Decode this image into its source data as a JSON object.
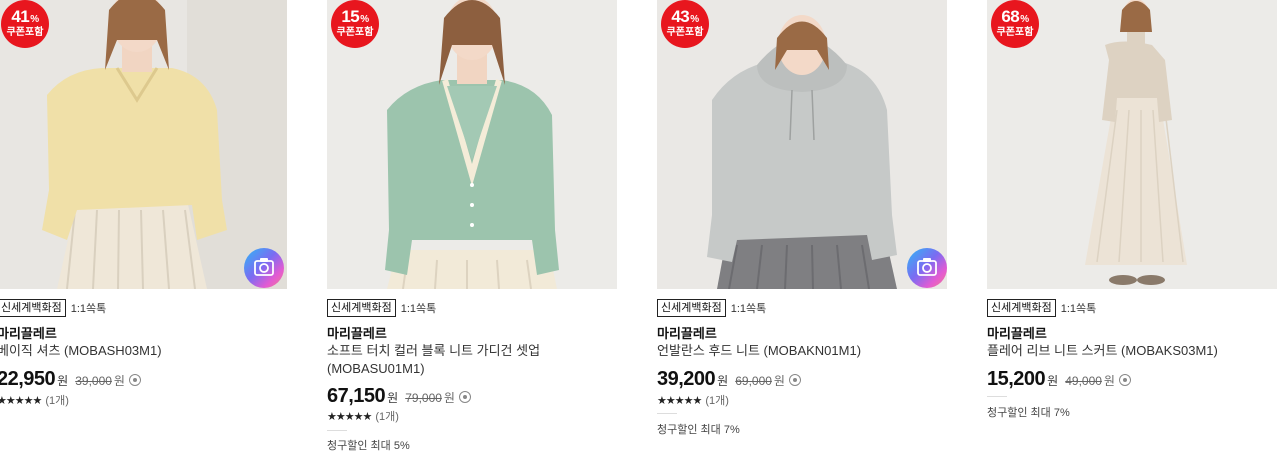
{
  "products": [
    {
      "discount": "41",
      "percent_sign": "%",
      "coupon": "쿠폰포함",
      "store": "신세계백화점",
      "chat": "1:1쏙톡",
      "brand": "마리끌레르",
      "name": "베이직 셔츠 (MOBASH03M1)",
      "price": "22,950",
      "won": "원",
      "original_price": "39,000",
      "original_won": "원",
      "stars": "★★★★★",
      "review_count": "(1개)",
      "promo": "",
      "has_camera": true,
      "garment_color": "#f0e0a8"
    },
    {
      "discount": "15",
      "percent_sign": "%",
      "coupon": "쿠폰포함",
      "store": "신세계백화점",
      "chat": "1:1쏙톡",
      "brand": "마리끌레르",
      "name": "소프트 터치 컬러 블록 니트 가디건 셋업 (MOBASU01M1)",
      "price": "67,150",
      "won": "원",
      "original_price": "79,000",
      "original_won": "원",
      "stars": "★★★★★",
      "review_count": "(1개)",
      "promo": "청구할인 최대 5%",
      "has_camera": false,
      "garment_color": "#9cc4ad"
    },
    {
      "discount": "43",
      "percent_sign": "%",
      "coupon": "쿠폰포함",
      "store": "신세계백화점",
      "chat": "1:1쏙톡",
      "brand": "마리끌레르",
      "name": "언발란스 후드 니트 (MOBAKN01M1)",
      "price": "39,200",
      "won": "원",
      "original_price": "69,000",
      "original_won": "원",
      "stars": "★★★★★",
      "review_count": "(1개)",
      "promo": "청구할인 최대 7%",
      "has_camera": true,
      "garment_color": "#c6c9c8"
    },
    {
      "discount": "68",
      "percent_sign": "%",
      "coupon": "쿠폰포함",
      "store": "신세계백화점",
      "chat": "1:1쏙톡",
      "brand": "마리끌레르",
      "name": "플레어 리브 니트 스커트 (MOBAKS03M1)",
      "price": "15,200",
      "won": "원",
      "original_price": "49,000",
      "original_won": "원",
      "stars": "",
      "review_count": "",
      "promo": "청구할인 최대 7%",
      "has_camera": false,
      "garment_color": "#ddd2c2"
    }
  ],
  "icons": {
    "camera": "camera-icon",
    "info": "info-circle-icon",
    "star": "star-icon"
  },
  "colors": {
    "badge": "#e8161e",
    "text": "#222222",
    "background": "#ffffff"
  }
}
